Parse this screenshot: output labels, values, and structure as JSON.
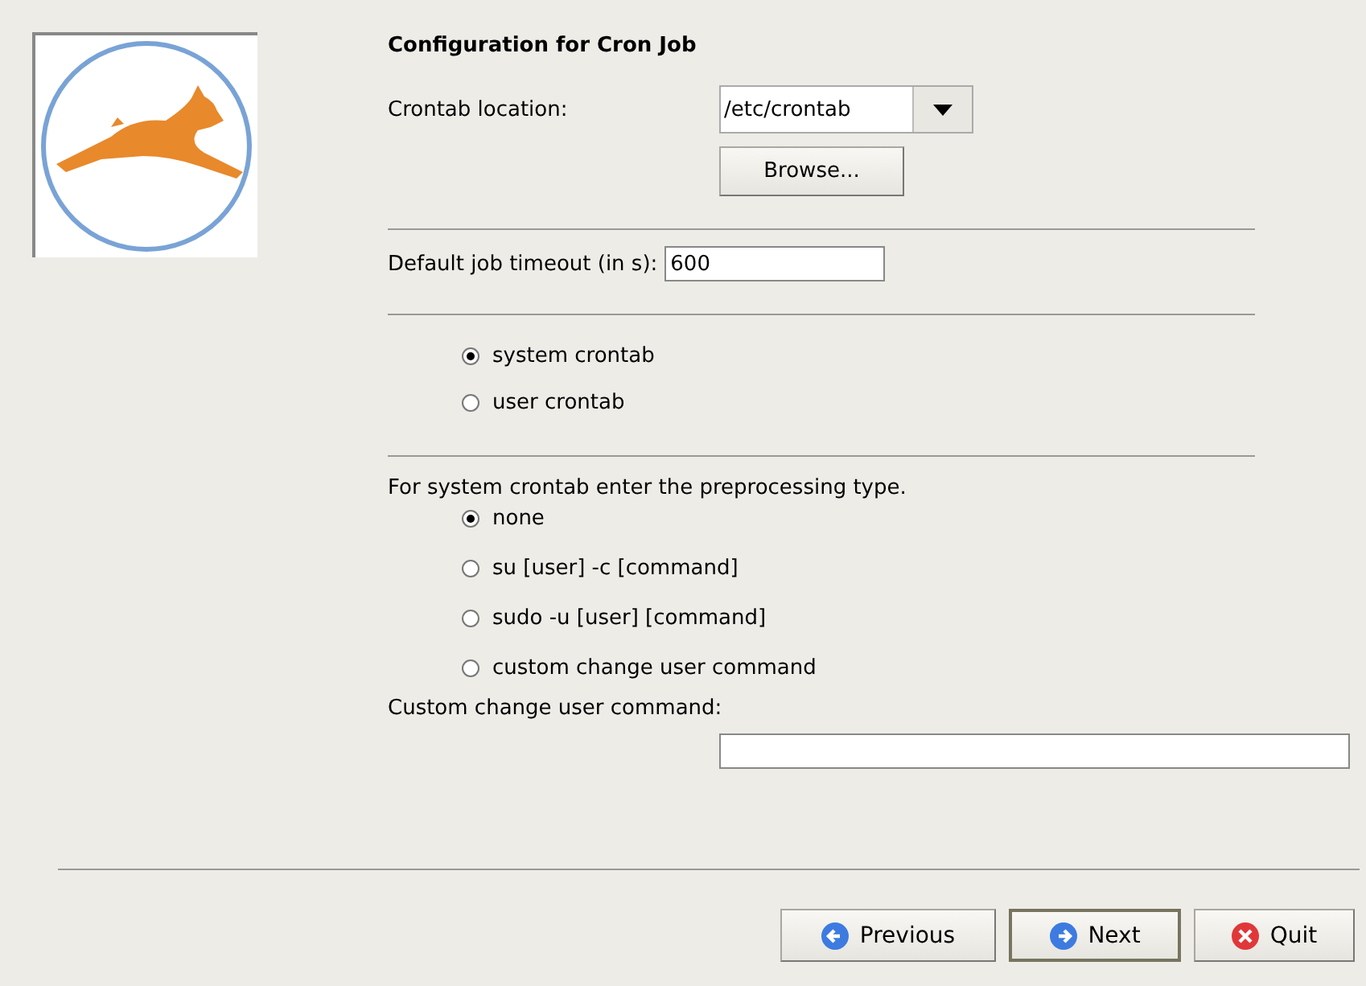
{
  "heading": "Configuration for Cron Job",
  "crontab_location": {
    "label": "Crontab location:",
    "value": "/etc/crontab",
    "browse": "Browse..."
  },
  "timeout": {
    "label": "Default job timeout (in s):",
    "value": "600"
  },
  "crontab_type": [
    {
      "label": "system crontab",
      "selected": true
    },
    {
      "label": "user crontab",
      "selected": false
    }
  ],
  "preprocessing": {
    "label": "For system crontab enter the preprocessing type.",
    "options": [
      {
        "label": "none",
        "selected": true
      },
      {
        "label": "su [user] -c [command]",
        "selected": false
      },
      {
        "label": "sudo -u [user] [command]",
        "selected": false
      },
      {
        "label": "custom change user command",
        "selected": false
      }
    ]
  },
  "custom_command": {
    "label": "Custom change user command:"
  },
  "buttons": [
    {
      "label": "Previous",
      "kind": "previous",
      "focused": false
    },
    {
      "label": "Next",
      "kind": "next",
      "focused": true
    },
    {
      "label": "Quit",
      "kind": "quit",
      "focused": false
    }
  ]
}
